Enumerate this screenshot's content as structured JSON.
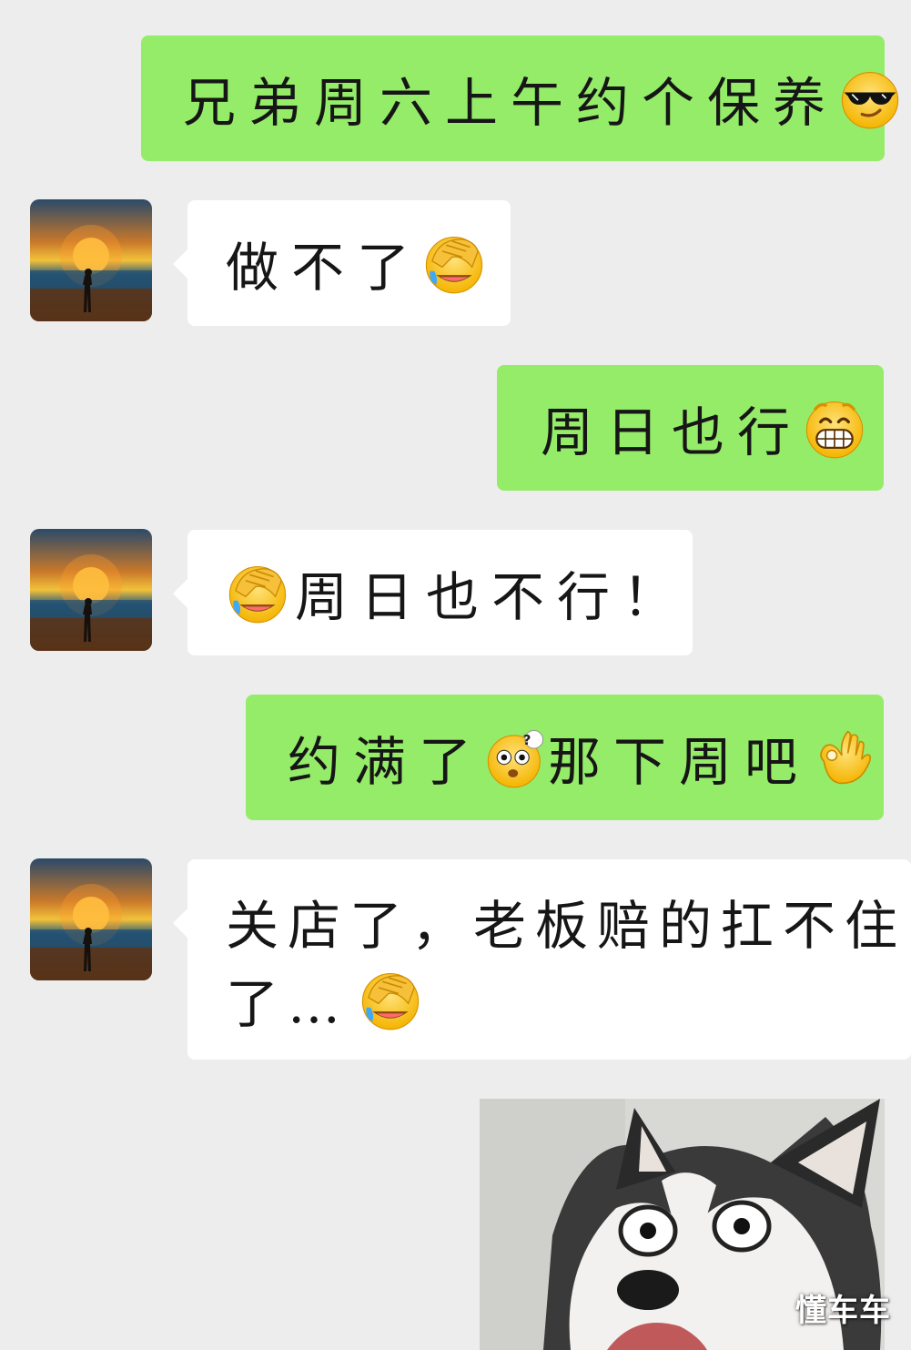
{
  "messages": [
    {
      "side": "out",
      "text": "兄弟周六上午约个保养",
      "emoji": "cool-sunglasses-emoji"
    },
    {
      "side": "in",
      "text": "做不了",
      "emoji": "facepalm-emoji"
    },
    {
      "side": "out",
      "text": "周日也行",
      "emoji": "grin-emoji"
    },
    {
      "side": "in",
      "text_after": "周日也不行！",
      "emoji": "facepalm-emoji"
    },
    {
      "side": "out",
      "text_a": "约满了",
      "text_b": "那下周吧",
      "emoji_a": "confused-question-emoji",
      "emoji_b": "ok-hand-emoji"
    },
    {
      "side": "in",
      "line1": "关店了，老板赔的扛不住",
      "line2": "了…",
      "emoji": "facepalm-emoji"
    }
  ],
  "image_message": {
    "subject": "husky-dog-photo"
  },
  "watermark": "懂车车",
  "colors": {
    "outgoing_bubble": "#95ec69",
    "incoming_bubble": "#ffffff",
    "background": "#ededed"
  }
}
